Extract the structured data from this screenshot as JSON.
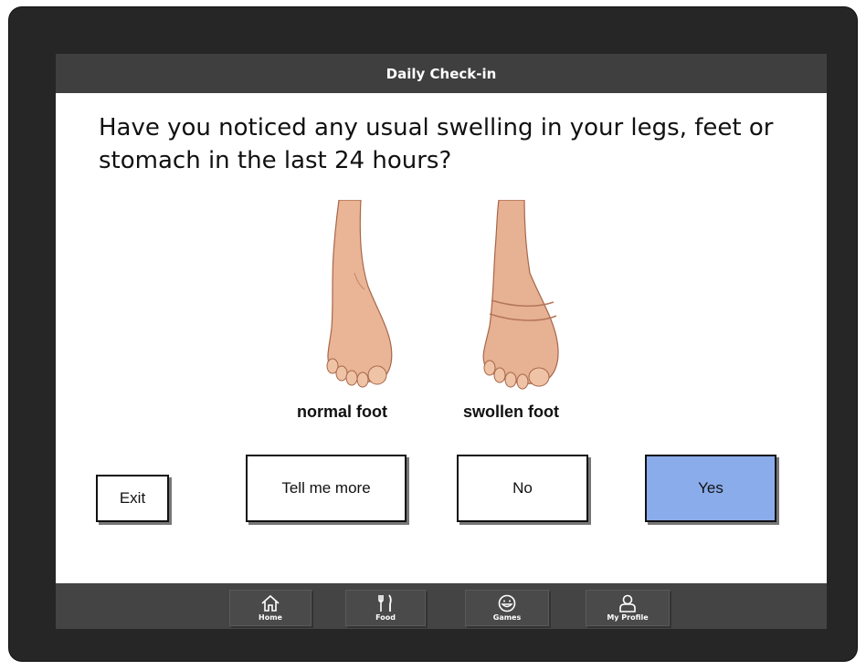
{
  "header": {
    "title": "Daily Check-in"
  },
  "question": "Have you noticed any usual swelling in your legs, feet or stomach in the last 24 hours?",
  "images": [
    {
      "caption": "normal foot",
      "icon": "normal-foot-illustration"
    },
    {
      "caption": "swollen foot",
      "icon": "swollen-foot-illustration"
    }
  ],
  "buttons": {
    "exit": "Exit",
    "more": "Tell me more",
    "no": "No",
    "yes": "Yes"
  },
  "nav": {
    "home": "Home",
    "food": "Food",
    "games": "Games",
    "profile": "My Profile"
  },
  "colors": {
    "frame": "#262626",
    "titlebar": "#3f3f3f",
    "yes_button": "#8aacea",
    "navbar": "#444444"
  }
}
